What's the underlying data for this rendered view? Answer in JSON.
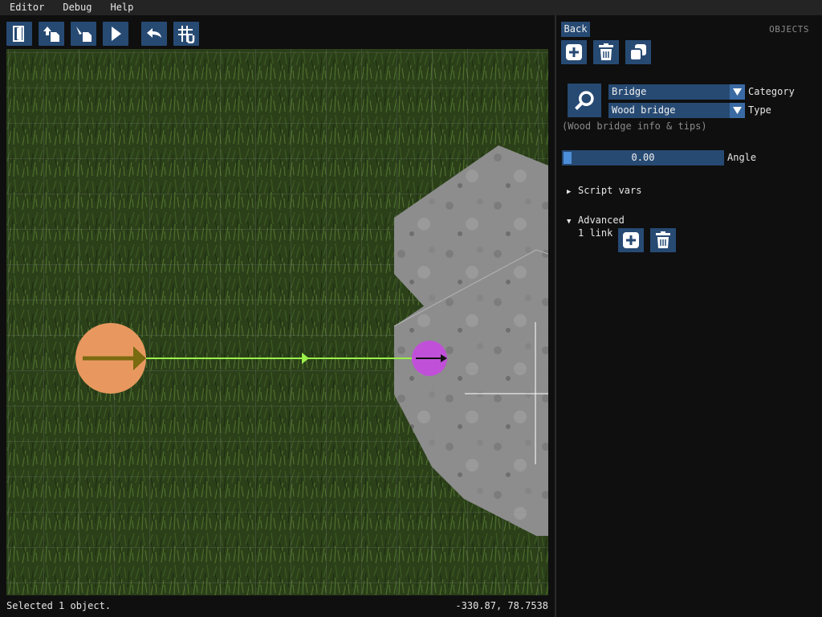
{
  "menu": [
    "Editor",
    "Debug",
    "Help"
  ],
  "toolbar": [
    {
      "name": "exit-door-icon"
    },
    {
      "name": "upload-arrow-icon"
    },
    {
      "name": "reload-file-icon"
    },
    {
      "name": "play-icon"
    },
    {
      "name": "undo-icon"
    },
    {
      "name": "grid-snap-icon"
    }
  ],
  "status": {
    "message": "Selected 1 object.",
    "coordinates": "-330.87, 78.7538"
  },
  "panel": {
    "back_label": "Back",
    "title": "OBJECTS",
    "category_value": "Bridge",
    "category_label": "Category",
    "type_value": "Wood bridge",
    "type_label": "Type",
    "info": "(Wood bridge info & tips)",
    "angle_value": "0.00",
    "angle_label": "Angle",
    "script_vars_label": "Script vars",
    "advanced_label": "Advanced",
    "links_text": "1 link"
  },
  "colors": {
    "button_bg": "#274a73",
    "accent": "#4d8ed8",
    "link_line": "#9bf04a",
    "start_object": "#e8985f",
    "end_object": "#c050d8",
    "grass": "#2a3f1a",
    "rock": "#8a8a8a"
  }
}
